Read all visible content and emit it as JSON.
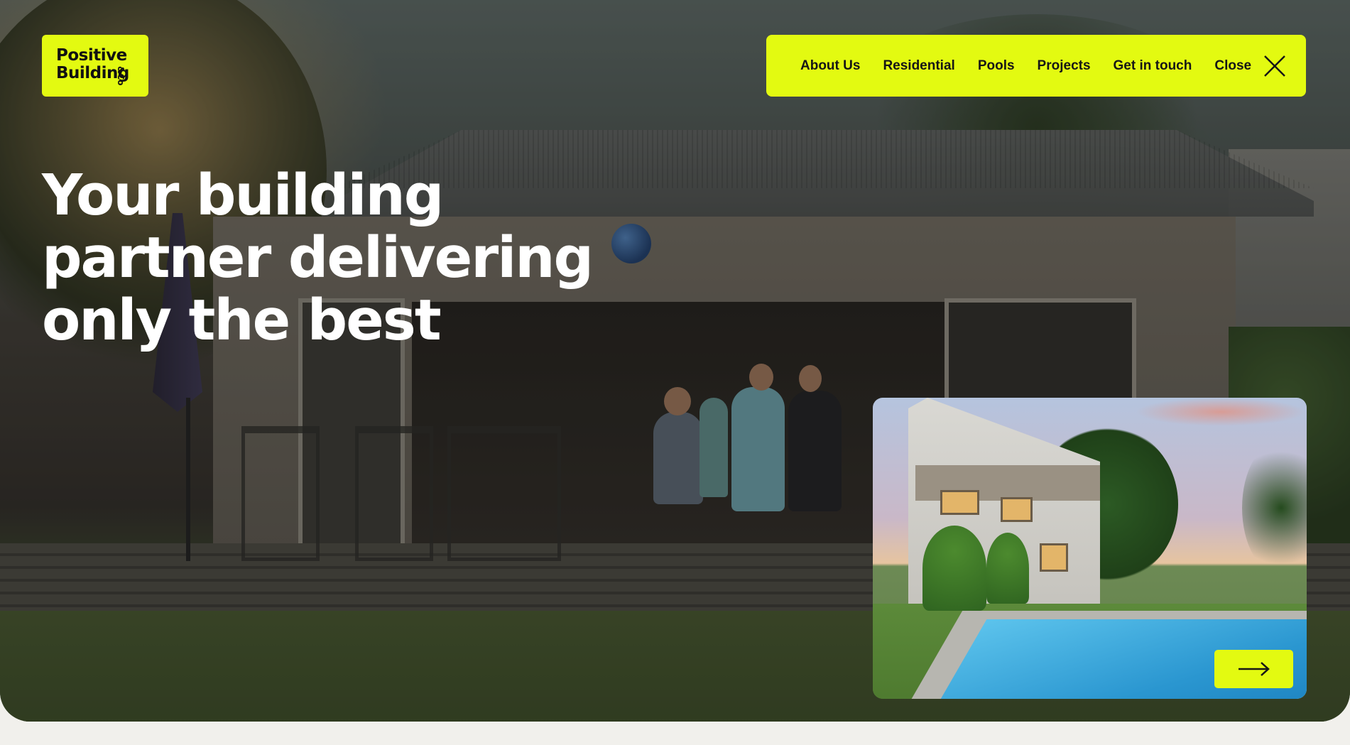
{
  "brand": {
    "logo_text": "Positive\nBuilding",
    "logo_suffix": "&Co",
    "accent_color": "#e3fa11"
  },
  "nav": {
    "items": [
      {
        "label": "About Us"
      },
      {
        "label": "Residential"
      },
      {
        "label": "Pools"
      },
      {
        "label": "Projects"
      },
      {
        "label": "Get in touch"
      }
    ],
    "close_label": "Close",
    "close_icon": "close-icon"
  },
  "hero": {
    "headline": "Your building partner delivering only the best"
  },
  "feature_card": {
    "arrow_icon": "arrow-right-icon"
  }
}
